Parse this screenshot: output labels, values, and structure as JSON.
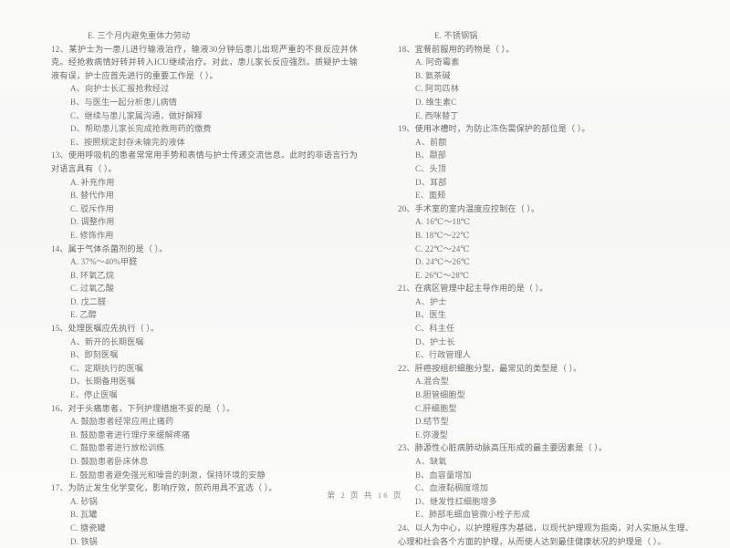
{
  "document": {
    "type": "scanned-exam-paper",
    "language": "zh-CN",
    "page_footer": "第 2 页 共 16 页"
  },
  "left_column": {
    "lead_option": "E. 三个月内避免重体力劳动",
    "questions": [
      {
        "number": "12、",
        "stem": "某护士为一患儿进行输液治疗，输液30分钟后患儿出现严重的不良反应并休克。经抢救病情好转并转入ICU继续治疗。对此，患儿家长反应强烈。质疑护士输液有误，护士应首先进行的重要工作是（    ）。",
        "options": [
          "A、向护士长汇报抢救经过",
          "B、与医生一起分析患儿病情",
          "C、继续与患儿家属沟通，做好解释",
          "D、帮助患儿家长完成抢救用药的缴费",
          "E、按照规定封存未输完的液体"
        ]
      },
      {
        "number": "13、",
        "stem": "使用呼吸机的患者常常用手势和表情与护士传递交流信息。此时的非语言行为对语言具有（    ）。",
        "options": [
          "A. 补充作用",
          "B. 替代作用",
          "C. 驳斥作用",
          "D. 调整作用",
          "E. 修饰作用"
        ]
      },
      {
        "number": "14、",
        "stem": "属于气体杀菌剂的是（    ）。",
        "options": [
          "A.  37%～40%甲醛",
          "B.  环氧乙烷",
          "C.  过氧乙酸",
          "D.  戊二醛",
          "E.  乙醇"
        ]
      },
      {
        "number": "15、",
        "stem": "处理医嘱应先执行（    ）。",
        "options": [
          "A、新开的长期医嘱",
          "B、即刻医嘱",
          "C、定期执行的医嘱",
          "D、长期备用医嘱",
          "E、停止医嘱"
        ]
      },
      {
        "number": "16、",
        "stem": "对于头痛患者，下列护理措施不妥的是（    ）。",
        "options": [
          "A.  鼓励患者经常应用止痛药",
          "B.  鼓励患者进行理疗来缓解疼痛",
          "C.  鼓励患者进行放松训练",
          "D.  鼓励患者卧床休息",
          "E.  鼓励患者避免强光和噪音的刺激，保持环境的安静"
        ]
      },
      {
        "number": "17、",
        "stem": "为防止发生化学变化，影响疗效，煎药用具不宜选（    ）。",
        "options": [
          "A.  砂锅",
          "B.  瓦罐",
          "C.  搪瓷罐",
          "D.  铁锅"
        ]
      }
    ]
  },
  "right_column": {
    "lead_option": "E.  不锈钢锅",
    "questions": [
      {
        "number": "18、",
        "stem": "宜餐前服用的药物是（    ）。",
        "options": [
          "A. 阿奇霉素",
          "B. 氨茶碱",
          "C. 阿司匹林",
          "D. 维生素C",
          "E. 西咪替丁"
        ]
      },
      {
        "number": "19、",
        "stem": "使用冰槽时，为防止冻伤需保护的部位是（    ）。",
        "options": [
          "A、前额",
          "B、颞部",
          "C、头顶",
          "D、耳部",
          "E、面颊"
        ]
      },
      {
        "number": "20、",
        "stem": "手术室的室内温度应控制在（    ）。",
        "options": [
          "A. 16℃～18℃",
          "B. 18℃～22℃",
          "C. 22℃～24℃",
          "D. 24℃～26℃",
          "E. 26℃～28℃"
        ]
      },
      {
        "number": "21、",
        "stem": "在病区管理中起主导作用的是（    ）。",
        "options": [
          "A、护士",
          "B、医生",
          "C、科主任",
          "D、护士长",
          "E、行政管理人"
        ]
      },
      {
        "number": "22、",
        "stem": "肝癌按组织细胞分型，最常见的类型是（    ）。",
        "options": [
          "A.混合型",
          "B.胆管细胞型",
          "C.肝细胞型",
          "D.结节型",
          "E.弥漫型"
        ]
      },
      {
        "number": "23、",
        "stem": "肺源性心脏病肺动脉高压形成的最主要因素是（    ）。",
        "options": [
          "A、缺氧",
          "B、血容量增加",
          "C、血液黏稠度增加",
          "D、继发性红细胞增多",
          "E、肺部毛细血管微小栓子形成"
        ]
      },
      {
        "number": "24、",
        "stem": "以人为中心，以护理程序为基础，以现代护理观为指南，对人实施从生理、心理和社会各个方面的护理，从而使人达到最佳健康状况的护理是（    ）。",
        "options": []
      }
    ]
  }
}
